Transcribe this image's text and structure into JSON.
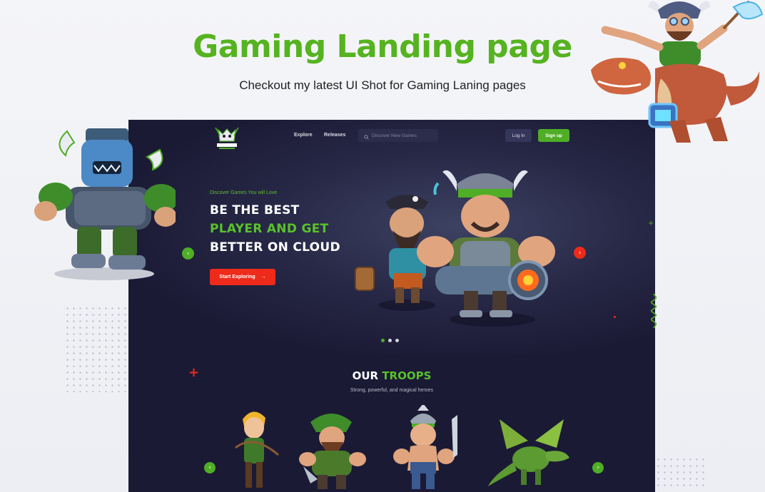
{
  "header": {
    "title": "Gaming Landing page",
    "subtitle": "Checkout my latest UI Shot for Gaming Laning pages"
  },
  "site": {
    "nav": {
      "links": [
        "Explore",
        "Releases"
      ],
      "search_placeholder": "Discover New Games",
      "login_label": "Log In",
      "signup_label": "Sign up"
    },
    "hero": {
      "eyebrow": "Discover Games You will Love",
      "line1": "BE THE BEST",
      "line2": "PLAYER AND GET",
      "line3": "BETTER ON CLOUD",
      "cta_label": "Start Exploring",
      "slides_total": 3,
      "slide_active": 1
    },
    "troops": {
      "title_white": "OUR",
      "title_green": "TROOPS",
      "subtitle": "Strong, powerful, and magical heroes"
    }
  },
  "icons": {
    "search": "search-icon",
    "cta_arrow": "arrow-right-icon",
    "prev": "chevron-left-icon",
    "next": "chevron-right-icon"
  },
  "colors": {
    "brand_green": "#56b320",
    "cta_red": "#ee2a1b",
    "frame_bg": "#1b1a35"
  }
}
